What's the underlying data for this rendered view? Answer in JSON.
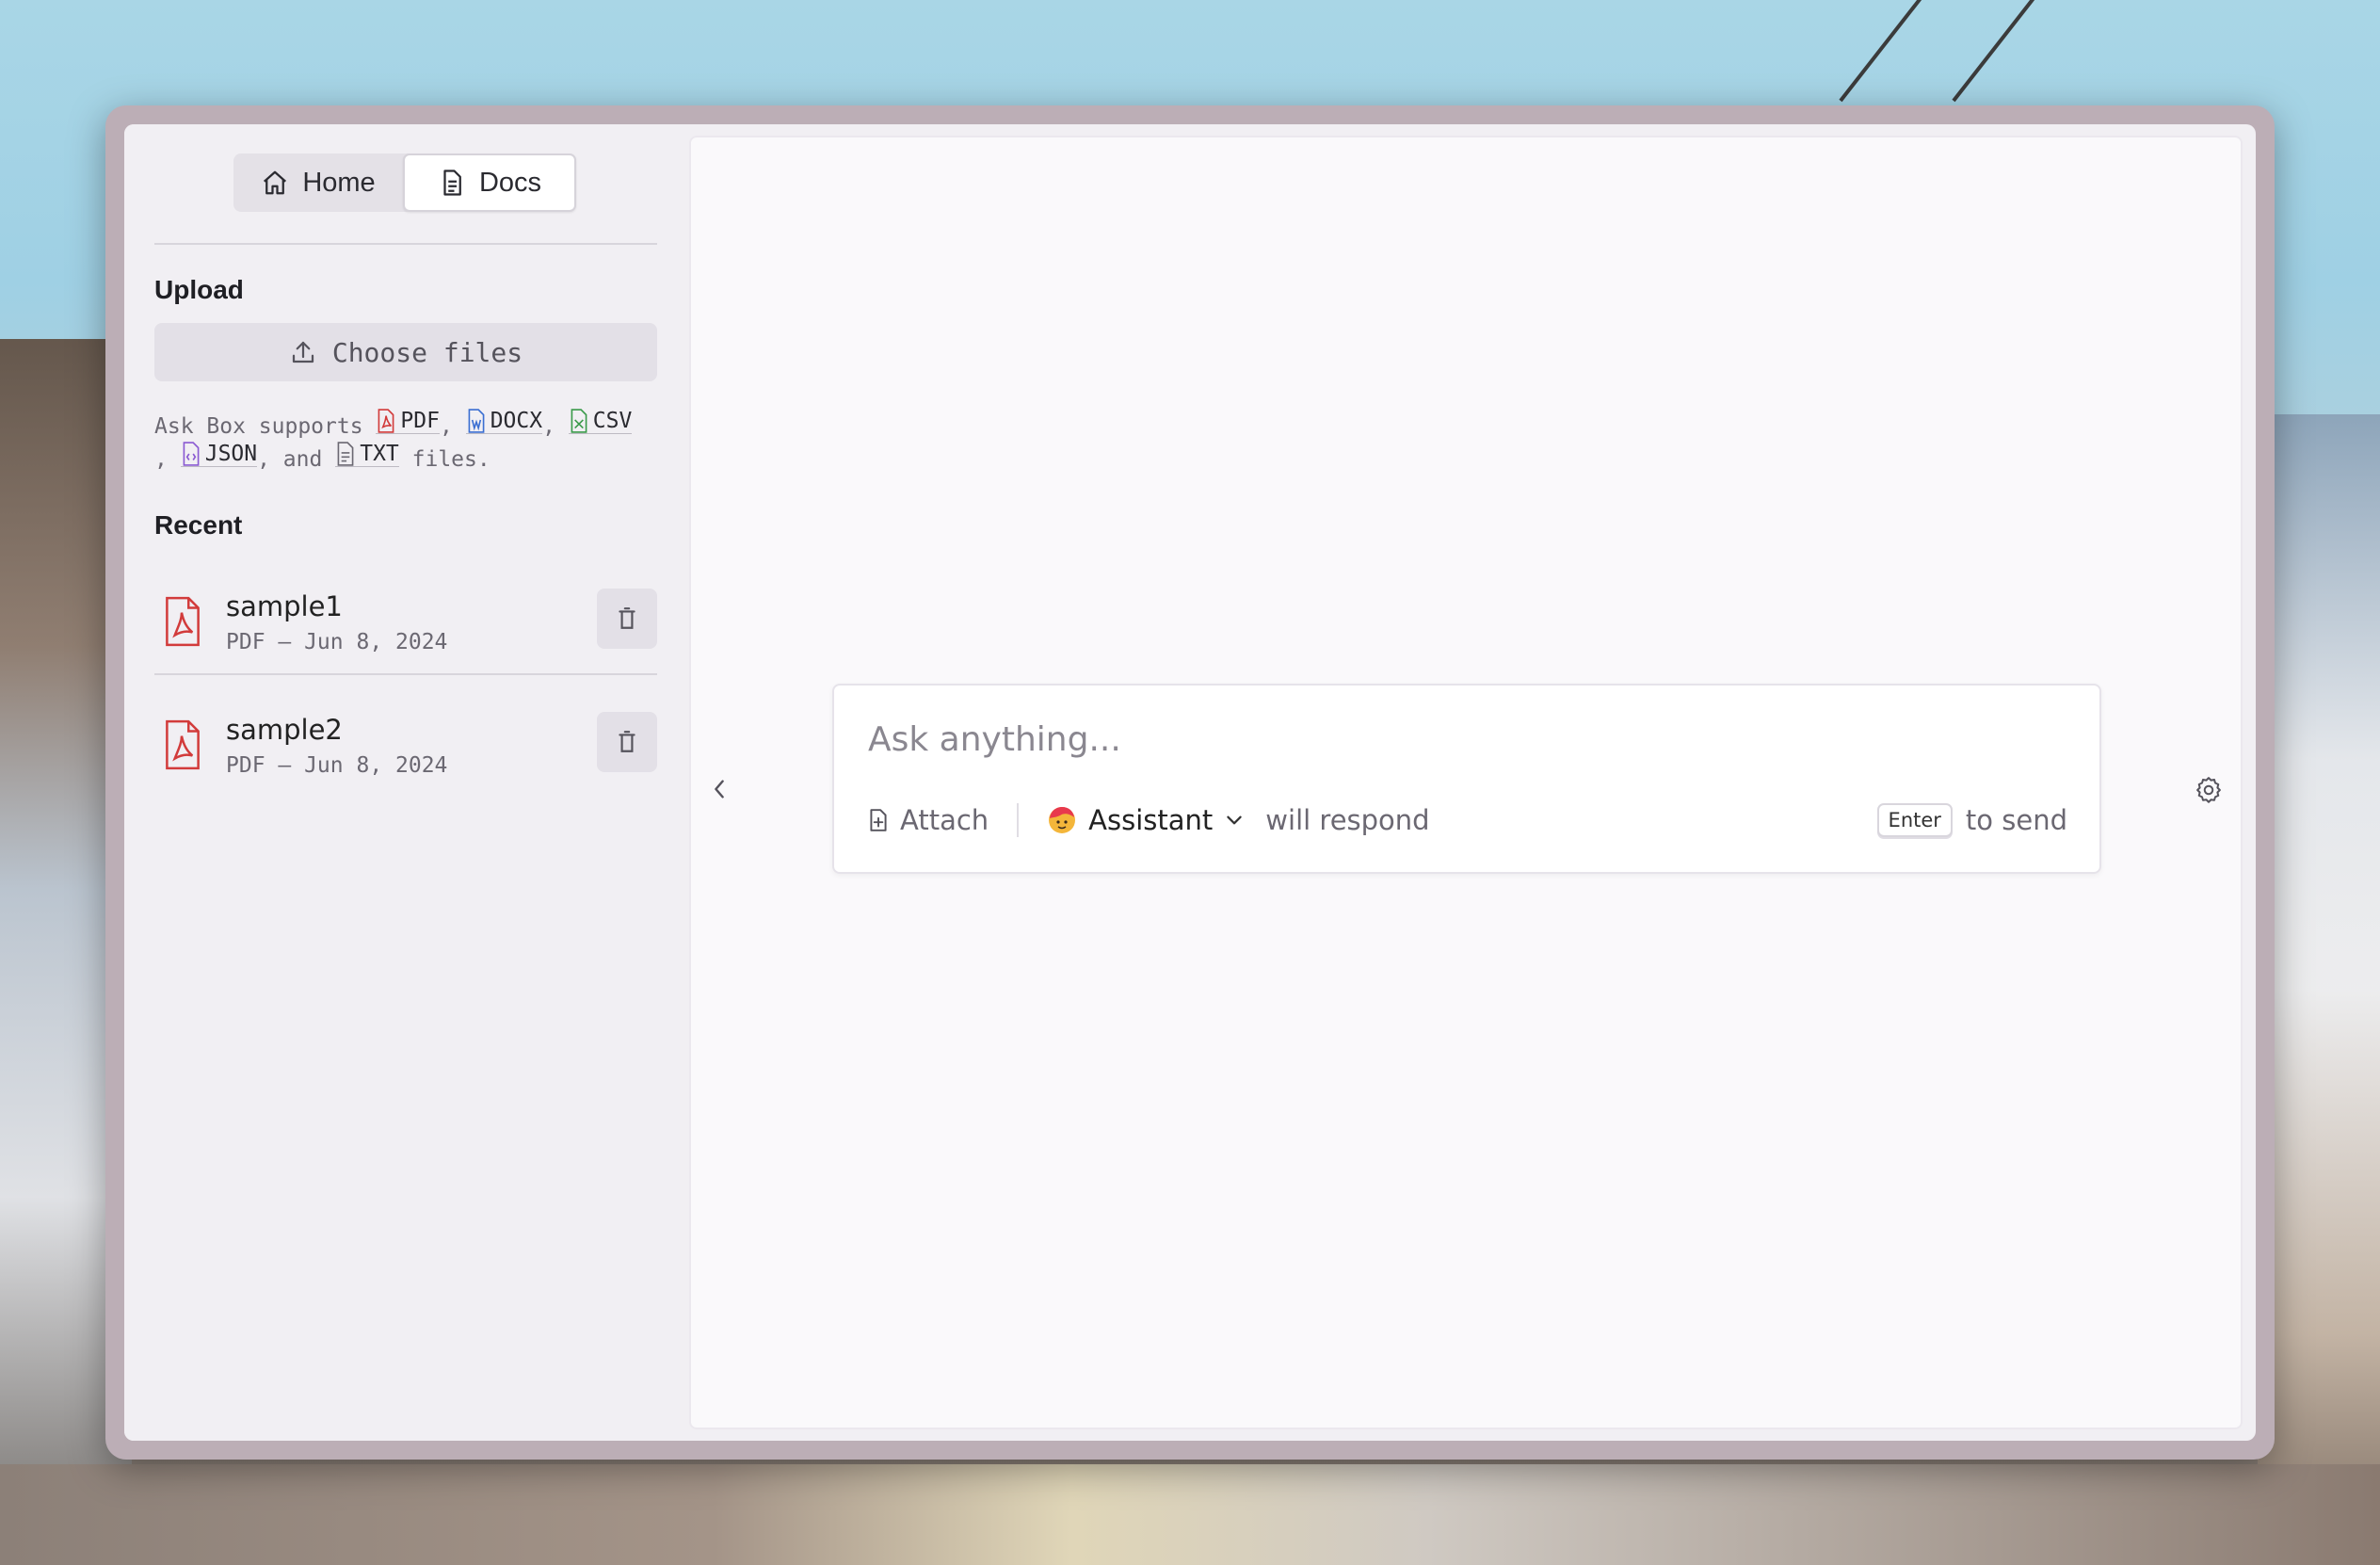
{
  "tabs": [
    {
      "label": "Home",
      "icon": "home-icon",
      "active": false
    },
    {
      "label": "Docs",
      "icon": "document-icon",
      "active": true
    }
  ],
  "upload": {
    "title": "Upload",
    "choose_label": "Choose files",
    "supports_prefix": "Ask Box supports",
    "types": [
      "PDF",
      "DOCX",
      "CSV",
      "JSON",
      "TXT"
    ],
    "sep": ",",
    "and_word": ", and",
    "suffix": "files."
  },
  "recent": {
    "title": "Recent",
    "items": [
      {
        "name": "sample1",
        "meta": "PDF — Jun 8, 2024"
      },
      {
        "name": "sample2",
        "meta": "PDF — Jun 8, 2024"
      }
    ]
  },
  "chat": {
    "placeholder": "Ask anything...",
    "attach_label": "Attach",
    "assistant_label": "Assistant",
    "will_respond": "will respond",
    "key_label": "Enter",
    "send_hint": "to send"
  },
  "colors": {
    "pdf": "#d23b3b",
    "docx": "#3b6fd2",
    "csv": "#3a9a4a",
    "json": "#8a5ad2"
  }
}
